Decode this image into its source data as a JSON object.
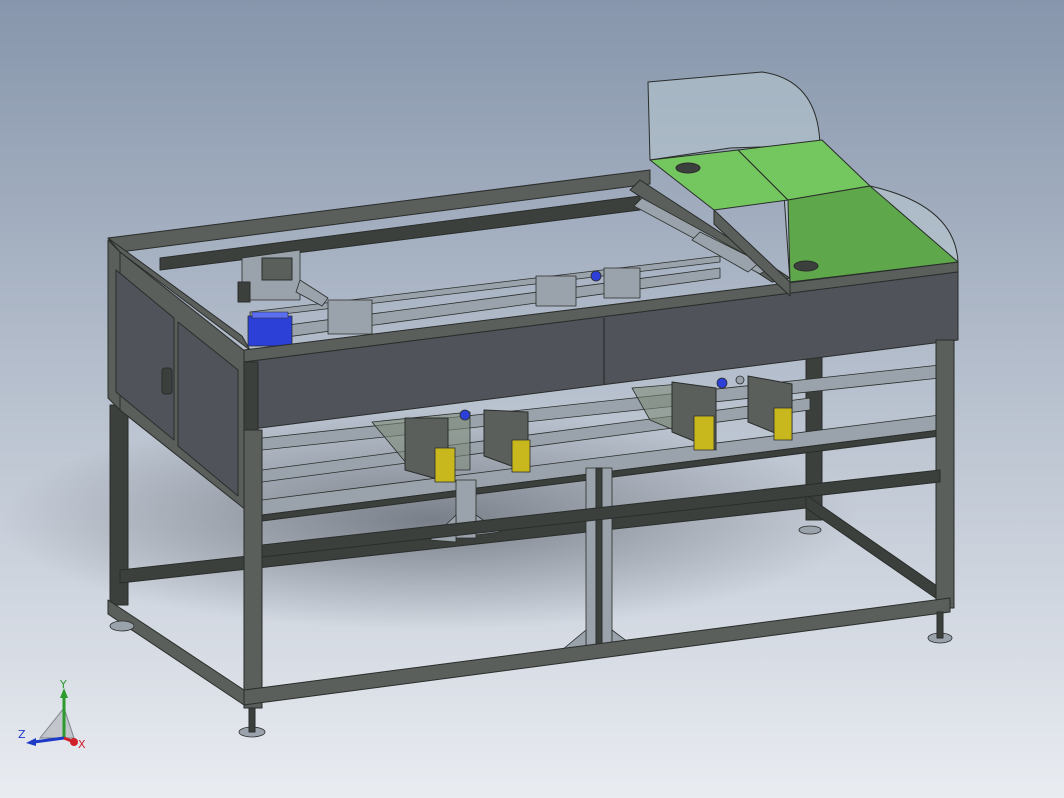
{
  "viewport": {
    "background_top": "#8796ac",
    "background_bottom": "#e9ecf1"
  },
  "colors": {
    "frame": "#5b5f5b",
    "frame_dark": "#3c403d",
    "frame_edge": "#2a2d2b",
    "panel": "#50545a",
    "rail": "#9aa3ab",
    "green_top": "#74c65e",
    "green_side": "#5ea84b",
    "glass": "#b8c9cf",
    "yellow": "#c8b81e",
    "motor_blue": "#2c3fd6",
    "axis_x": "#d0202a",
    "axis_y": "#2c9a2c",
    "axis_z": "#1e38c8"
  },
  "triad": {
    "x_label": "X",
    "y_label": "Y",
    "z_label": "Z"
  }
}
